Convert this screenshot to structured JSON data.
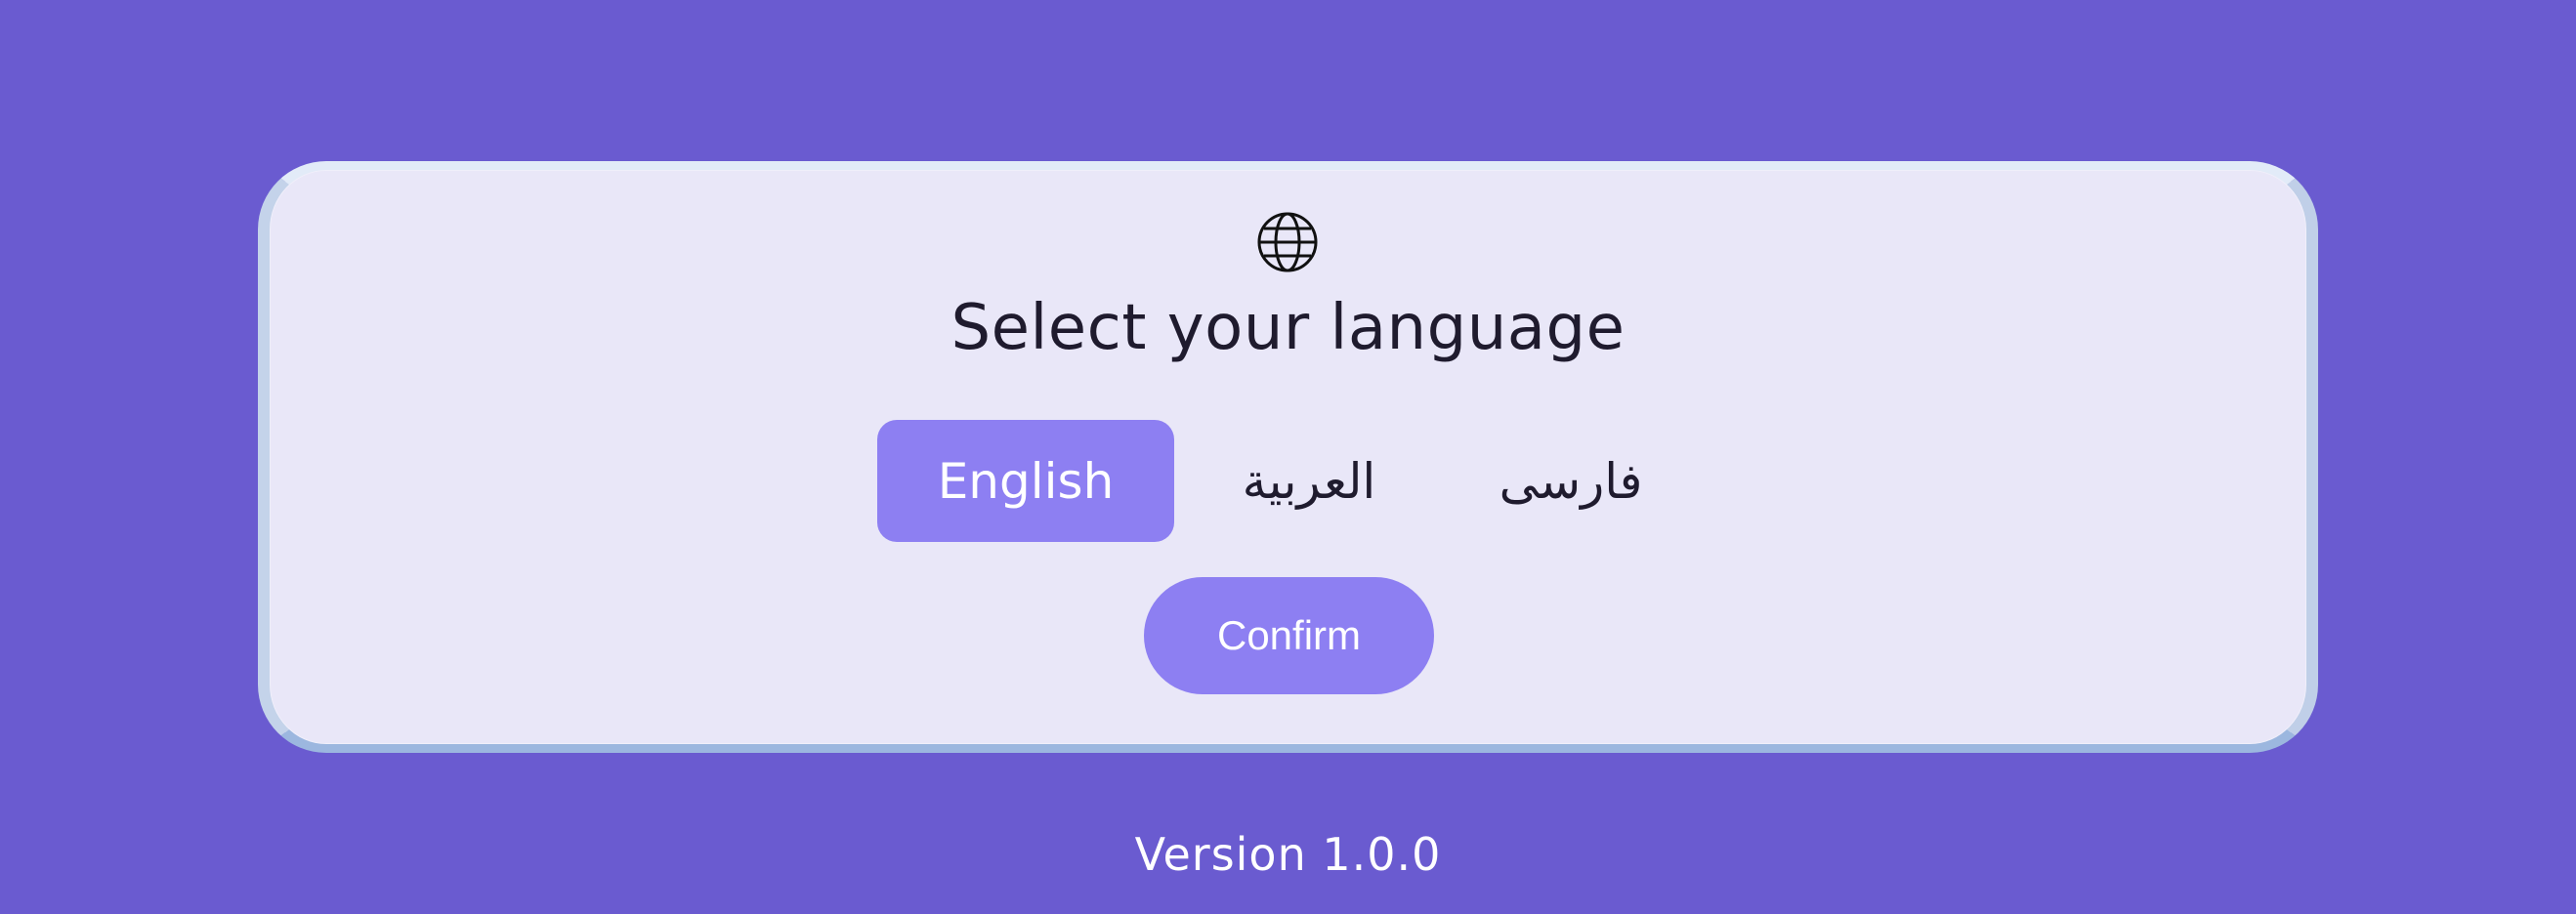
{
  "dialog": {
    "icon": "globe-icon",
    "title": "Select your language",
    "languages": [
      {
        "label": "English",
        "selected": true
      },
      {
        "label": "العربية",
        "selected": false
      },
      {
        "label": "فارسی",
        "selected": false
      }
    ],
    "confirm_label": "Confirm"
  },
  "footer": {
    "version": "Version 1.0.0"
  },
  "colors": {
    "background": "#6a5bd0",
    "card": "#e9e7f8",
    "accent": "#8d7ff2",
    "text": "#1f1b2e"
  }
}
